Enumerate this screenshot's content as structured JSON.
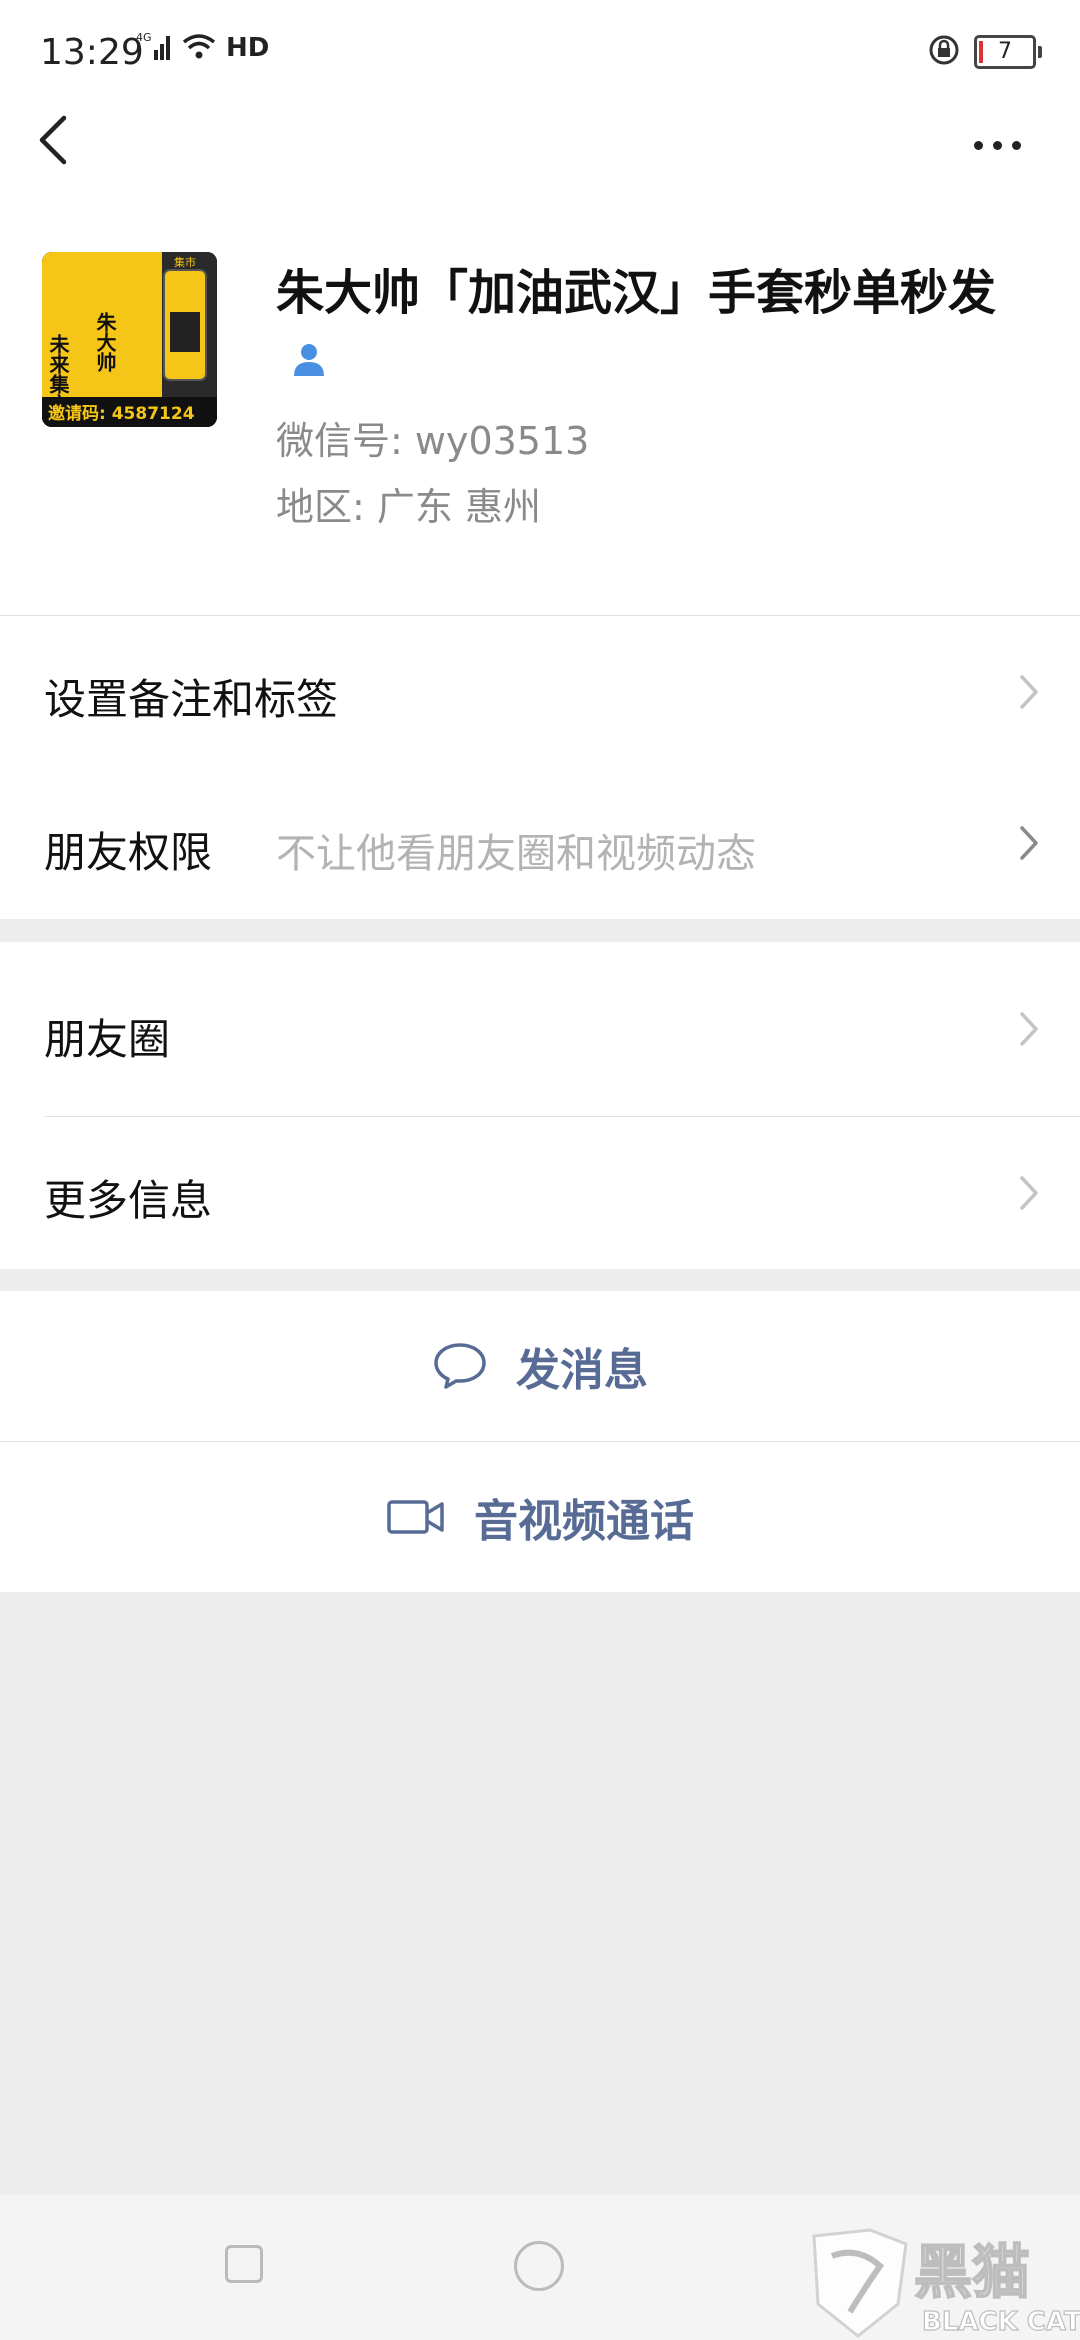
{
  "status_bar": {
    "time": "13:29",
    "network": "4G",
    "hd": "HD",
    "battery": "7"
  },
  "profile": {
    "name": "朱大帅「加油武汉」手套秒单秒发",
    "wechat_id": "微信号: wy03513",
    "region": "地区: 广东  惠州",
    "avatar": {
      "left_text": "未来集市",
      "right_text": "朱大帅",
      "invite": "邀请码: 4587124",
      "badge": "集市"
    }
  },
  "rows": {
    "remarks": {
      "label": "设置备注和标签"
    },
    "permissions": {
      "label": "朋友权限",
      "value": "不让他看朋友圈和视频动态"
    },
    "moments": {
      "label": "朋友圈"
    },
    "more_info": {
      "label": "更多信息"
    }
  },
  "actions": {
    "message": "发消息",
    "video_call": "音视频通话"
  },
  "watermark": {
    "cn": "黑猫",
    "en": "BLACK CAT"
  },
  "colors": {
    "accent": "#576b95",
    "background": "#ededed",
    "verified": "#4a90e2"
  }
}
